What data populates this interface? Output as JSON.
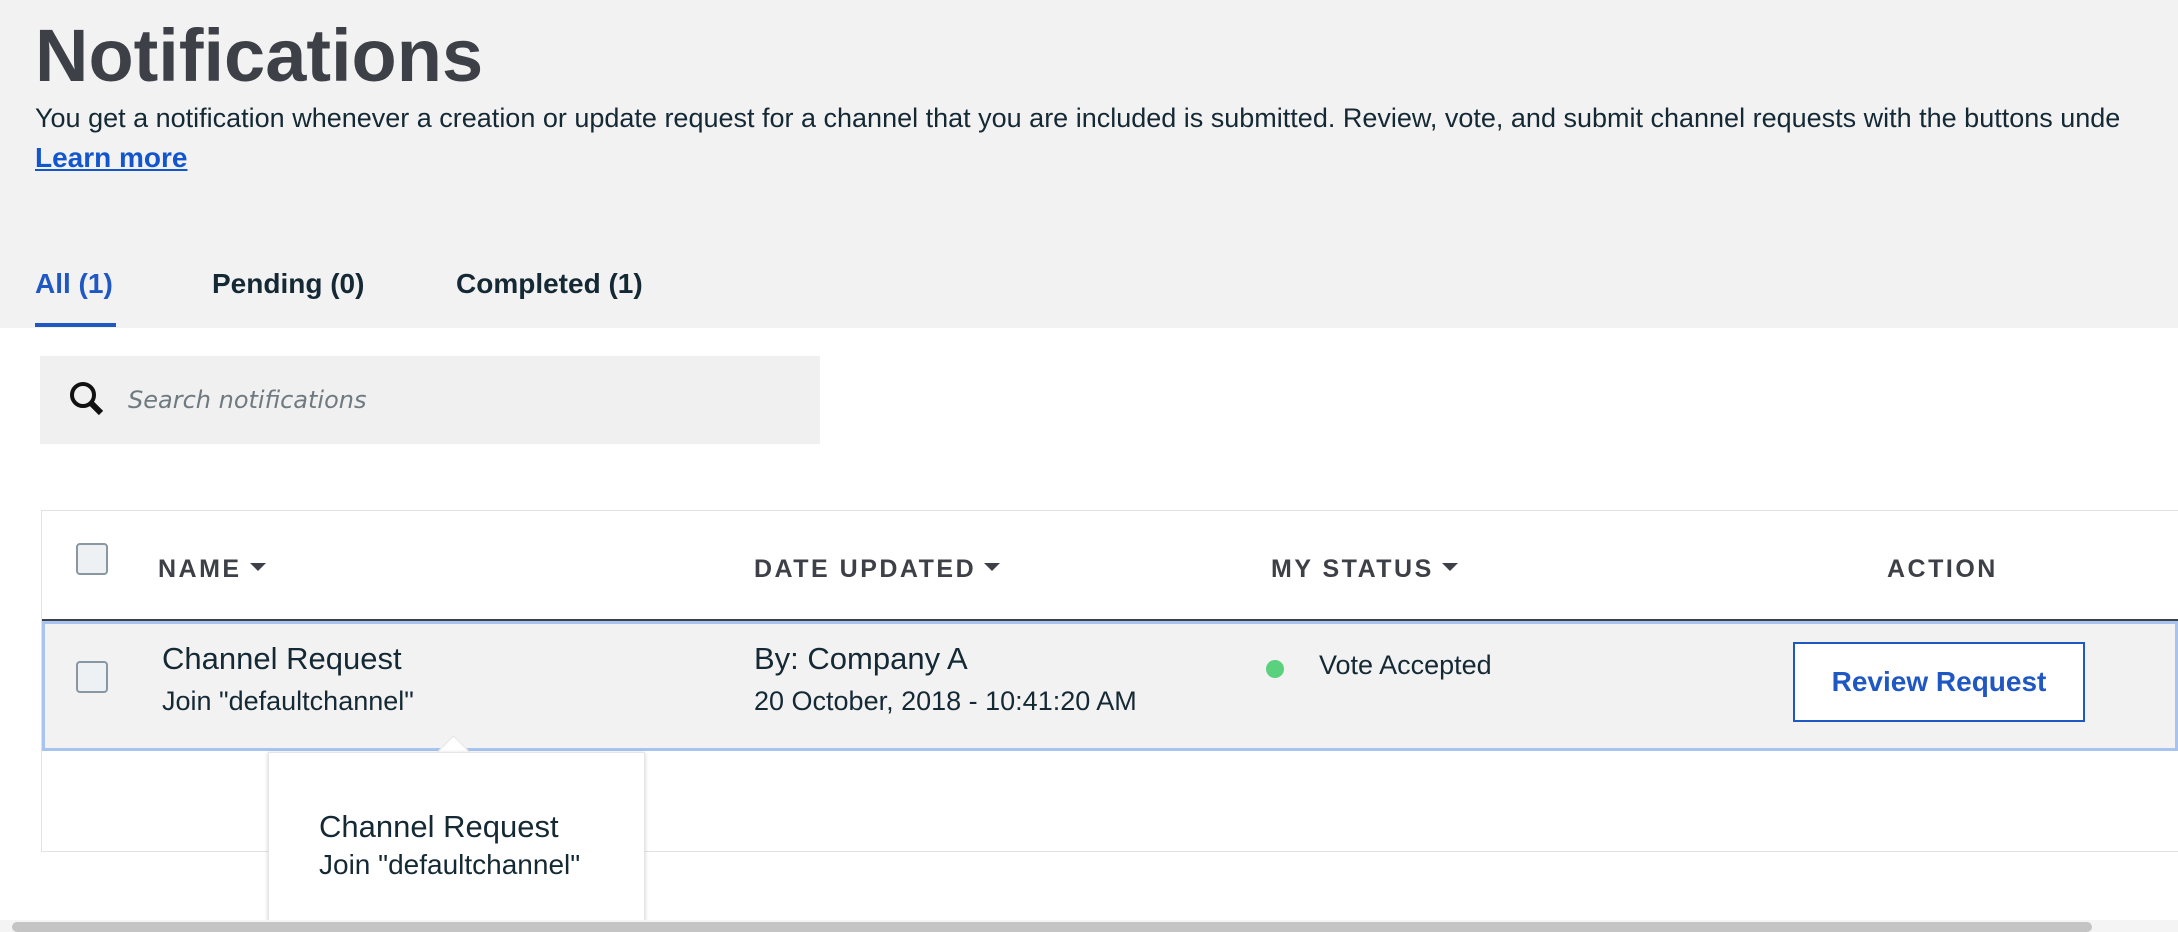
{
  "header": {
    "title": "Notifications",
    "description": "You get a notification whenever a creation or update request for a channel that you are included is submitted. Review, vote, and submit channel requests with the buttons unde",
    "learn_more": "Learn more"
  },
  "tabs": [
    {
      "label": "All (1)",
      "active": true
    },
    {
      "label": "Pending (0)",
      "active": false
    },
    {
      "label": "Completed (1)",
      "active": false
    }
  ],
  "search": {
    "placeholder": "Search notifications",
    "value": "",
    "icon": "search-icon"
  },
  "table": {
    "columns": {
      "name": "NAME",
      "date_updated": "DATE UPDATED",
      "my_status": "MY STATUS",
      "action": "ACTION"
    },
    "rows": [
      {
        "name": "Channel Request",
        "subtitle": "Join \"defaultchannel\"",
        "updated_by": "By: Company A",
        "date": "20 October, 2018 - 10:41:20 AM",
        "status": "Vote Accepted",
        "status_color": "#5ad17c",
        "action_label": "Review Request"
      }
    ]
  },
  "tooltip": {
    "title": "Channel Request",
    "subtitle": "Join \"defaultchannel\""
  },
  "colors": {
    "accent": "#1f57c3",
    "header_bg": "#f2f2f2",
    "row_highlight_border": "#a8c3ef"
  }
}
